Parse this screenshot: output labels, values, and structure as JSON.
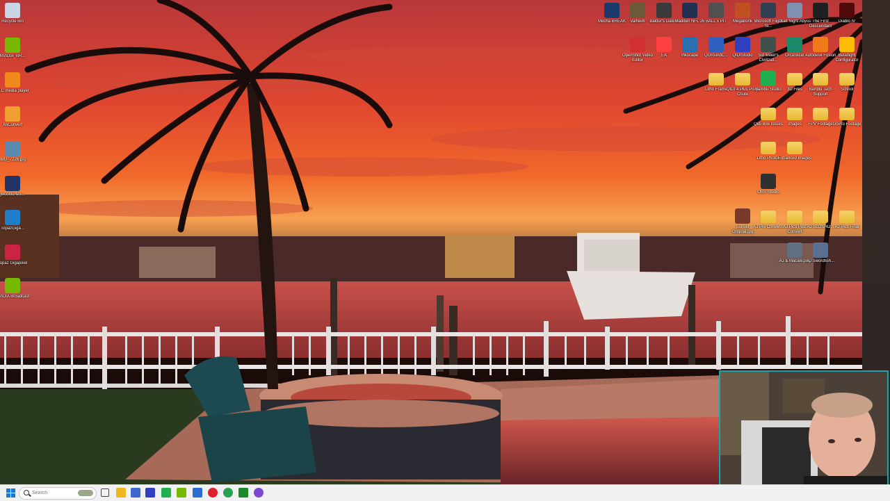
{
  "desktop": {
    "left_icons": [
      {
        "label": "Recycle Bin",
        "icon": "recycle-bin-icon",
        "color": "#c8d6e6"
      },
      {
        "label": "NVIDIA_BR...",
        "icon": "nvidia-icon",
        "color": "#76b900"
      },
      {
        "label": "VLC media player",
        "icon": "vlc-icon",
        "color": "#f08a1c"
      },
      {
        "label": "XnConvert",
        "icon": "xnconvert-icon",
        "color": "#f0a030"
      },
      {
        "label": "IMG_7226.jpg",
        "icon": "image-file-icon",
        "color": "#5a8ab0"
      },
      {
        "label": "jwcolourtes...",
        "icon": "image-file-icon",
        "color": "#223366"
      },
      {
        "label": "TopazGiga...",
        "icon": "topaz-icon",
        "color": "#1e7fc8"
      },
      {
        "label": "Topaz Gigapixel",
        "icon": "topaz-gigapixel-icon",
        "color": "#cc2244"
      },
      {
        "label": "NVIDIA Broadcast",
        "icon": "nvidia-broadcast-icon",
        "color": "#76b900"
      }
    ],
    "grid_icons": [
      {
        "label": "Mecha BREAK",
        "icon": "game-icon",
        "color": "#1a3a6a"
      },
      {
        "label": "Valheim",
        "icon": "game-icon",
        "color": "#6a5a3a"
      },
      {
        "label": "Baldur's Gate 3",
        "icon": "game-icon",
        "color": "#3a3a3a"
      },
      {
        "label": "Madden NFL 26",
        "icon": "game-icon",
        "color": "#203050"
      },
      {
        "label": "BALL x PIT",
        "icon": "game-icon",
        "color": "#505050"
      },
      {
        "label": "Megabonk",
        "icon": "game-icon",
        "color": "#c05020"
      },
      {
        "label": "Microsoft Flight Si...",
        "icon": "game-icon",
        "color": "#304050"
      },
      {
        "label": "Duet Night Abyss",
        "icon": "game-icon",
        "color": "#8090b0"
      },
      {
        "label": "The First Descendant",
        "icon": "game-icon",
        "color": "#202020"
      },
      {
        "label": "Diablo IV",
        "icon": "game-icon",
        "color": "#500a0a"
      },
      {
        "label": "OpenShot Video Editor",
        "icon": "openshot-icon",
        "color": "#d03030"
      },
      {
        "label": "EA",
        "icon": "ea-icon",
        "color": "#ff4040"
      },
      {
        "label": "Inkscape",
        "icon": "inkscape-icon",
        "color": "#2a6fb0"
      },
      {
        "label": "QGroundC...",
        "icon": "qgroundcontrol-icon",
        "color": "#3060c0"
      },
      {
        "label": "QIDIStudio",
        "icon": "qidistudio-icon",
        "color": "#3040c0"
      },
      {
        "label": "Sid Meier's Civilizati...",
        "icon": "civilization-icon",
        "color": "#40504a"
      },
      {
        "label": "OrcaSlicer",
        "icon": "orcaslicer-icon",
        "color": "#1a8a6a"
      },
      {
        "label": "Autodesk Fusion",
        "icon": "fusion-icon",
        "color": "#f07a1a"
      },
      {
        "label": "Betaflight Configurator",
        "icon": "betaflight-icon",
        "color": "#ffbb00"
      },
      {
        "label": "Litho Frame",
        "icon": "folder-icon",
        "color": "#f0c850"
      },
      {
        "label": "QIDI 4 Plus Poop Chute",
        "icon": "folder-icon",
        "color": "#f0c850"
      },
      {
        "label": "Bambu Studio",
        "icon": "bambu-studio-icon",
        "color": "#20b050"
      },
      {
        "label": "3D Files",
        "icon": "folder-icon",
        "color": "#f0c850"
      },
      {
        "label": "Bambu Tech Support",
        "icon": "folder-icon",
        "color": "#f0c850"
      },
      {
        "label": "School",
        "icon": "folder-icon",
        "color": "#f0c850"
      },
      {
        "label": "Qidi Box Issues",
        "icon": "folder-icon",
        "color": "#f0c850"
      },
      {
        "label": "Images",
        "icon": "folder-icon",
        "color": "#f0c850"
      },
      {
        "label": "FPV Footage",
        "icon": "folder-icon",
        "color": "#f0c850"
      },
      {
        "label": "GoPro Footage",
        "icon": "folder-icon",
        "color": "#f0c850"
      },
      {
        "label": "Litho Photos",
        "icon": "folder-icon",
        "color": "#f0c850"
      },
      {
        "label": "Enhanced Images",
        "icon": "folder-icon",
        "color": "#f0c850"
      },
      {
        "label": "OBS Studio",
        "icon": "obs-icon",
        "color": "#303030"
      },
      {
        "label": "Sunset Original.jpg",
        "icon": "image-file-icon",
        "color": "#7a3a2a"
      },
      {
        "label": "AJ Pre Conver...",
        "icon": "folder-icon",
        "color": "#f0c850"
      },
      {
        "label": "AJ Pics Post Convert",
        "icon": "folder-icon",
        "color": "#f0c850"
      },
      {
        "label": "AJ SLOSHO...",
        "icon": "folder-icon",
        "color": "#f0c850"
      },
      {
        "label": "AJ Pics Final",
        "icon": "folder-icon",
        "color": "#f0c850"
      },
      {
        "label": "AJ & Macaw.png",
        "icon": "image-file-icon",
        "color": "#607080"
      },
      {
        "label": "AJ Swordfish...",
        "icon": "image-file-icon",
        "color": "#5a7090"
      }
    ]
  },
  "taskbar": {
    "search_placeholder": "Search",
    "items": [
      {
        "icon": "folder-icon",
        "color": "#f0b820"
      },
      {
        "icon": "store-icon",
        "color": "#3a6ad0"
      },
      {
        "icon": "qidistudio-icon",
        "color": "#3040c0"
      },
      {
        "icon": "bambu-studio-icon",
        "color": "#20b050"
      },
      {
        "icon": "nvidia-icon",
        "color": "#76b900"
      },
      {
        "icon": "notification-badge-icon",
        "color": "#2a6fd0"
      },
      {
        "icon": "opera-icon",
        "color": "#e0202a"
      },
      {
        "icon": "chrome-icon",
        "color": "#2aa050"
      },
      {
        "icon": "xbox-icon",
        "color": "#1a8a2a"
      },
      {
        "icon": "messenger-icon",
        "color": "#7a4ad0"
      }
    ]
  },
  "colors": {
    "accent": "#1fa3a8",
    "taskbar": "#f1f1f3"
  }
}
